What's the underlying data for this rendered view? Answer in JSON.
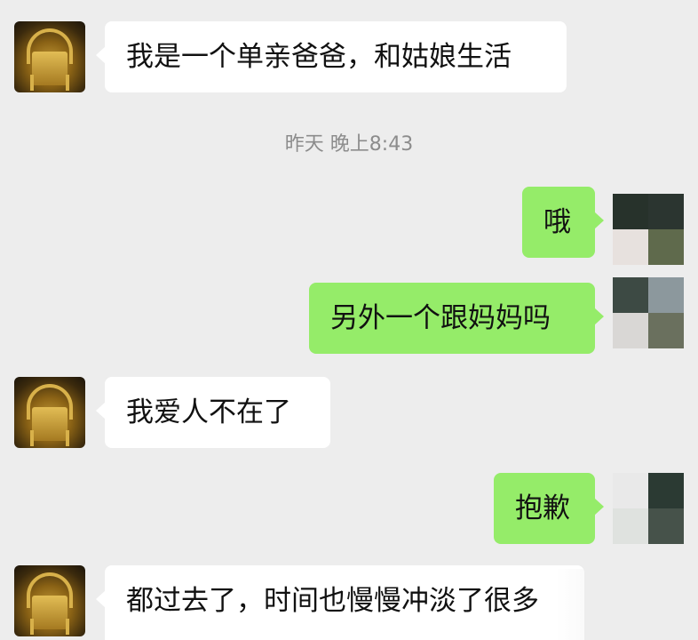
{
  "conversation": {
    "timestamp": "昨天 晚上8:43",
    "messages": [
      {
        "from": "them",
        "text": "我是一个单亲爸爸，和姑娘生活"
      },
      {
        "from": "me",
        "text": "哦"
      },
      {
        "from": "me",
        "text": "另外一个跟妈妈吗"
      },
      {
        "from": "them",
        "text": "我爱人不在了"
      },
      {
        "from": "me",
        "text": "抱歉"
      },
      {
        "from": "them",
        "text": "都过去了，时间也慢慢冲淡了很多"
      }
    ]
  },
  "colors": {
    "background": "#ededed",
    "incoming_bubble": "#ffffff",
    "outgoing_bubble": "#95ec69",
    "timestamp_text": "#8c8c8c"
  },
  "icons": {
    "contact_avatar": "golden-chair-avatar",
    "own_avatar": "pixelated-mosaic-avatar"
  }
}
